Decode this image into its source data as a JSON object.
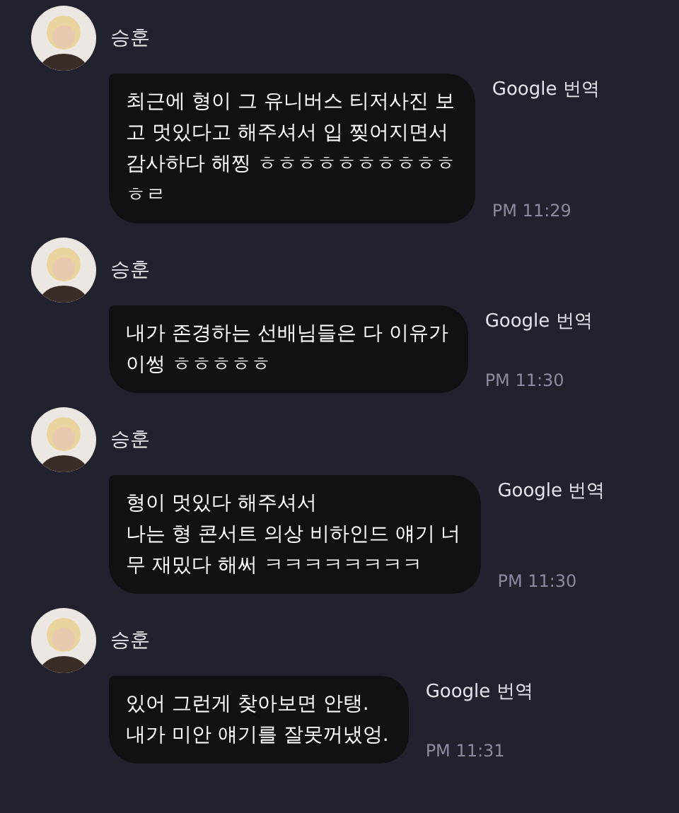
{
  "messages": [
    {
      "sender": "승훈",
      "lines": [
        "최근에 형이 그 유니버스 티저사진 보",
        "고 멋있다고 해주셔서 입 찢어지면서",
        "감사하다 해찡 ㅎㅎㅎㅎㅎㅎㅎㅎㅎㅎ",
        "ㅎㄹ"
      ],
      "translate": "Google 번역",
      "time": "PM 11:29"
    },
    {
      "sender": "승훈",
      "lines": [
        "내가 존경하는 선배님들은 다 이유가",
        "이썽 ㅎㅎㅎㅎㅎ"
      ],
      "translate": "Google 번역",
      "time": "PM 11:30"
    },
    {
      "sender": "승훈",
      "lines": [
        "형이 멋있다 해주셔서",
        "나는 형 콘서트 의상 비하인드 얘기 너",
        "무 재밌다 해써 ㅋㅋㅋㅋㅋㅋㅋㅋ"
      ],
      "translate": "Google 번역",
      "time": "PM 11:30"
    },
    {
      "sender": "승훈",
      "lines": [
        "있어 그런게 찾아보면 안탱.",
        "내가 미안 얘기를 잘못꺼냈엉."
      ],
      "translate": "Google 번역",
      "time": "PM 11:31"
    }
  ]
}
